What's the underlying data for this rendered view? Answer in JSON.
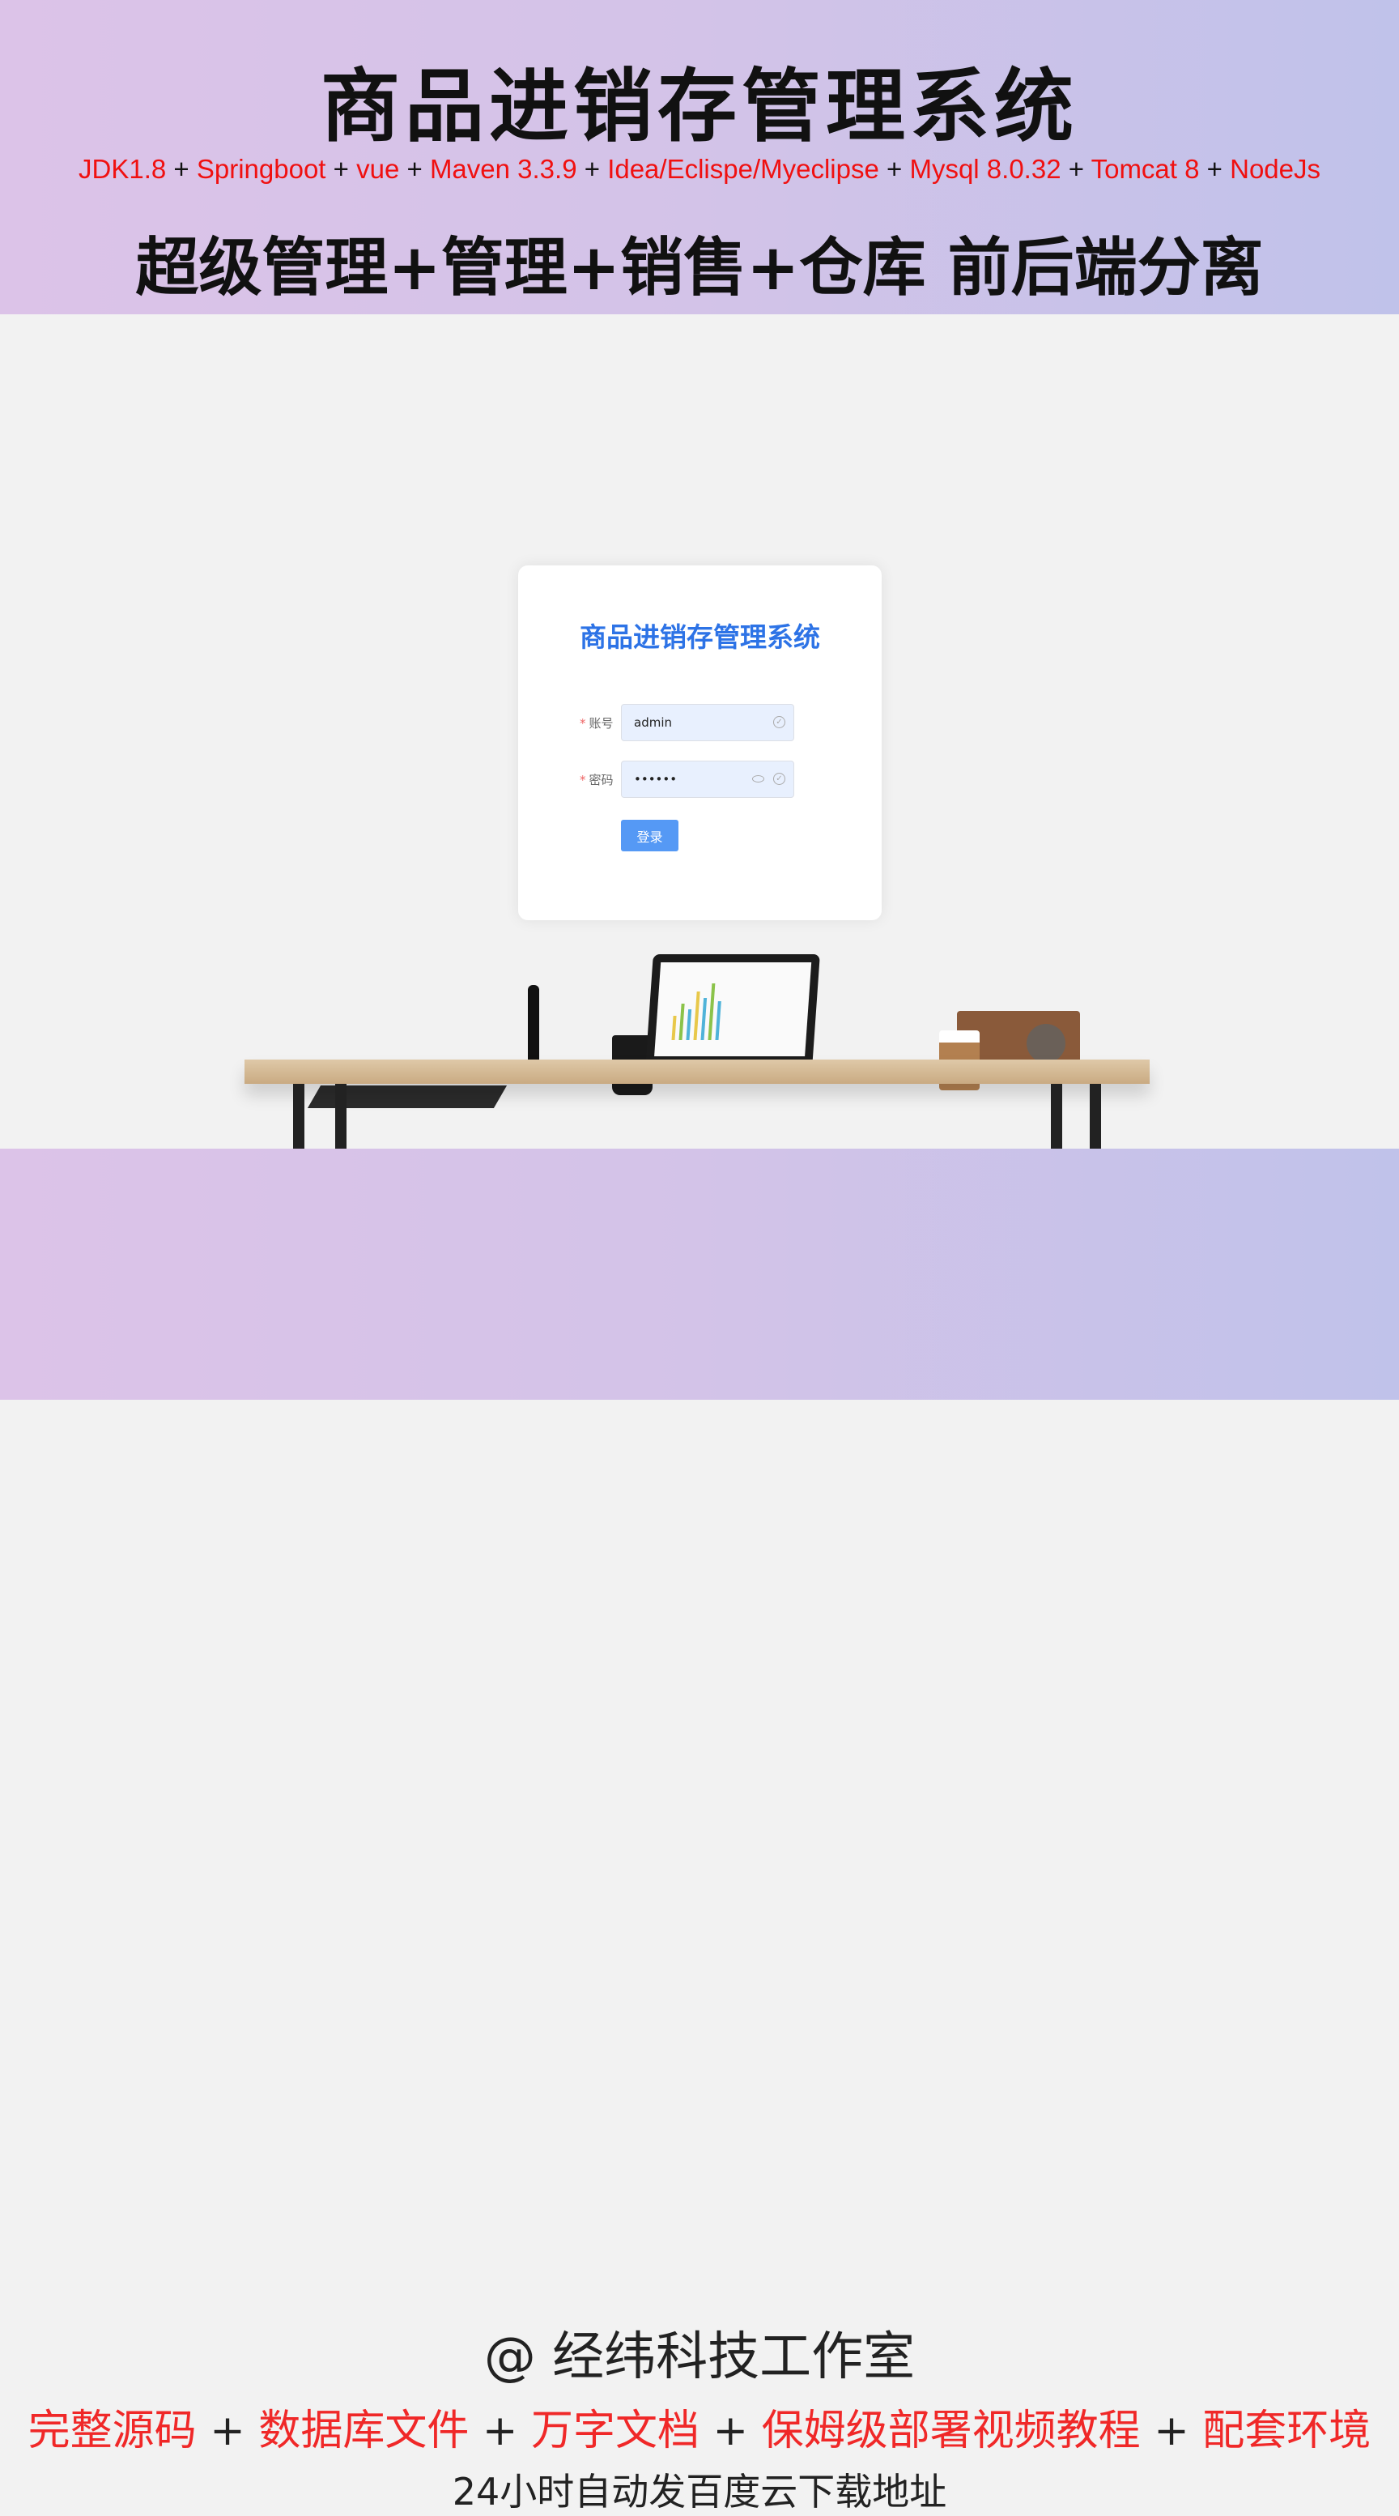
{
  "banner": {
    "title": "商品进销存管理系统",
    "tech_stack": [
      "JDK1.8",
      "Springboot",
      "vue",
      "Maven 3.3.9",
      "Idea/Eclispe/Myeclipse",
      "Mysql 8.0.32",
      "Tomcat 8",
      "NodeJs"
    ],
    "plus": "+",
    "subtitle": "超级管理+管理+销售+仓库 前后端分离"
  },
  "login": {
    "title": "商品进销存管理系统",
    "required_mark": "*",
    "account_label": "账号",
    "account_value": "admin",
    "password_label": "密码",
    "password_value": "••••••",
    "login_button": "登录",
    "title_color": "#2d73e6",
    "button_color": "#5599f5"
  },
  "footer": {
    "studio": "@ 经纬科技工作室",
    "features": [
      "完整源码",
      "数据库文件",
      "万字文档",
      "保姆级部署视频教程",
      "配套环境"
    ],
    "download": "24小时自动发百度云下载地址"
  }
}
